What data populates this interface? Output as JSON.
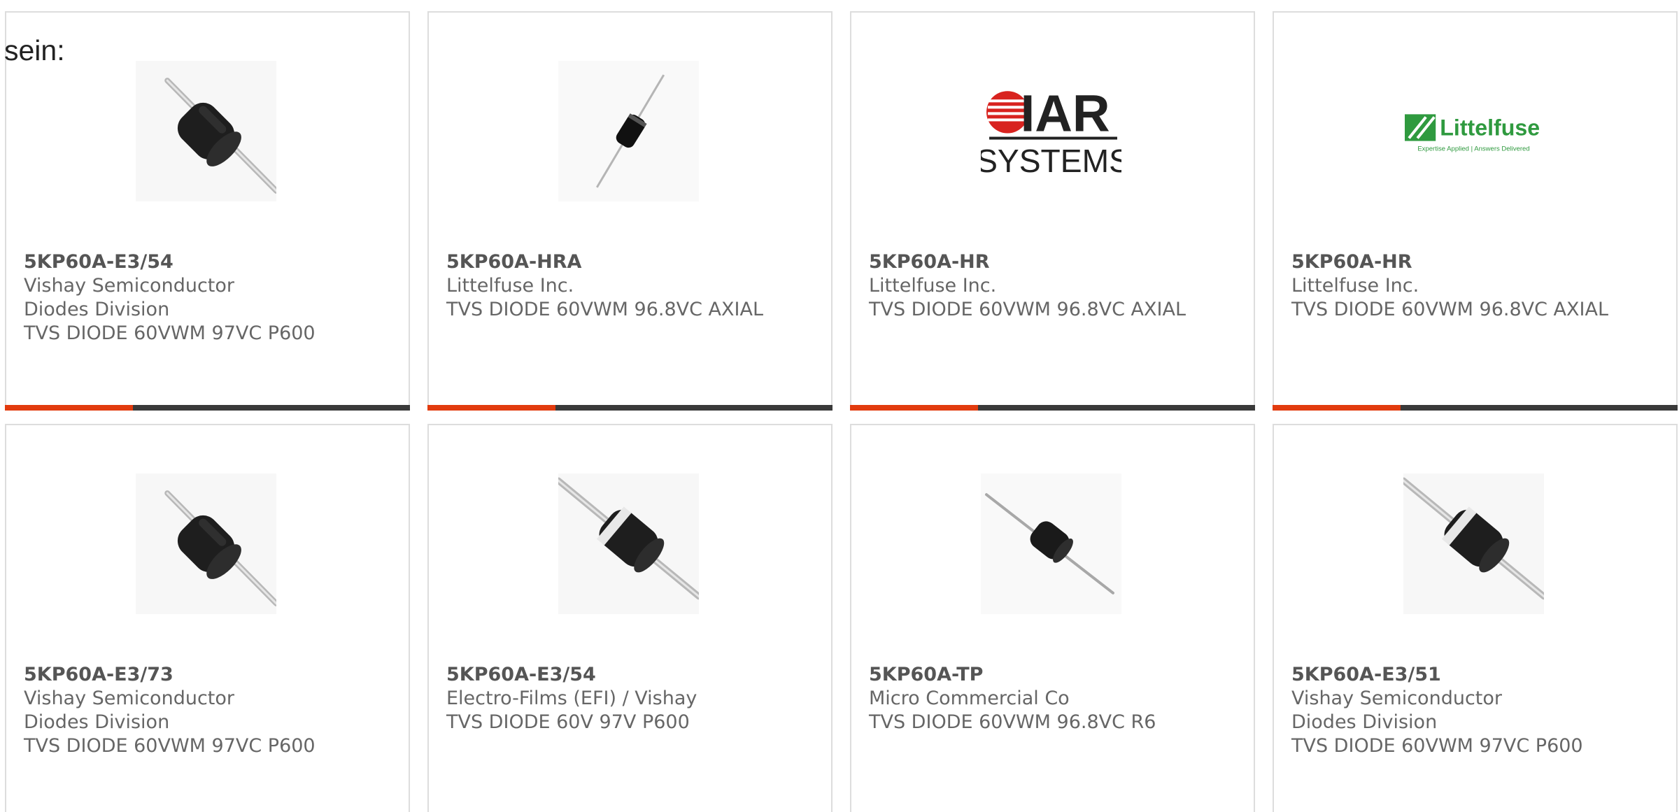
{
  "intro_text": "sein:",
  "colors": {
    "accent": "#e23b0e",
    "bar_dark": "#3a3a3a",
    "border": "#dddddd",
    "text": "#666666"
  },
  "cards": [
    {
      "part_number": "5KP60A-E3/54",
      "manufacturer": "Vishay Semiconductor Diodes Division",
      "description": "TVS DIODE 60VWM 97VC P600",
      "image": "diode-p600-icon"
    },
    {
      "part_number": "5KP60A-HRA",
      "manufacturer": "Littelfuse Inc.",
      "description": "TVS DIODE 60VWM 96.8VC AXIAL",
      "image": "diode-axial-icon"
    },
    {
      "part_number": "5KP60A-HR",
      "manufacturer": "Littelfuse Inc.",
      "description": "TVS DIODE 60VWM 96.8VC AXIAL",
      "image": "iar-systems-logo",
      "logo_text_top": "IAR",
      "logo_text_bottom": "SYSTEMS"
    },
    {
      "part_number": "5KP60A-HR",
      "manufacturer": "Littelfuse Inc.",
      "description": "TVS DIODE 60VWM 96.8VC AXIAL",
      "image": "littelfuse-logo",
      "logo_text": "Littelfuse",
      "logo_tagline": "Expertise Applied | Answers Delivered"
    },
    {
      "part_number": "5KP60A-E3/73",
      "manufacturer": "Vishay Semiconductor Diodes Division",
      "description": "TVS DIODE 60VWM 97VC P600",
      "image": "diode-p600-icon"
    },
    {
      "part_number": "5KP60A-E3/54",
      "manufacturer": "Electro-Films (EFI) / Vishay",
      "description": "TVS DIODE 60V 97V P600",
      "image": "diode-banded-icon"
    },
    {
      "part_number": "5KP60A-TP",
      "manufacturer": "Micro Commercial Co",
      "description": "TVS DIODE 60VWM 96.8VC R6",
      "image": "diode-r6-icon"
    },
    {
      "part_number": "5KP60A-E3/51",
      "manufacturer": "Vishay Semiconductor Diodes Division",
      "description": "TVS DIODE 60VWM 97VC P600",
      "image": "diode-banded-icon"
    }
  ]
}
